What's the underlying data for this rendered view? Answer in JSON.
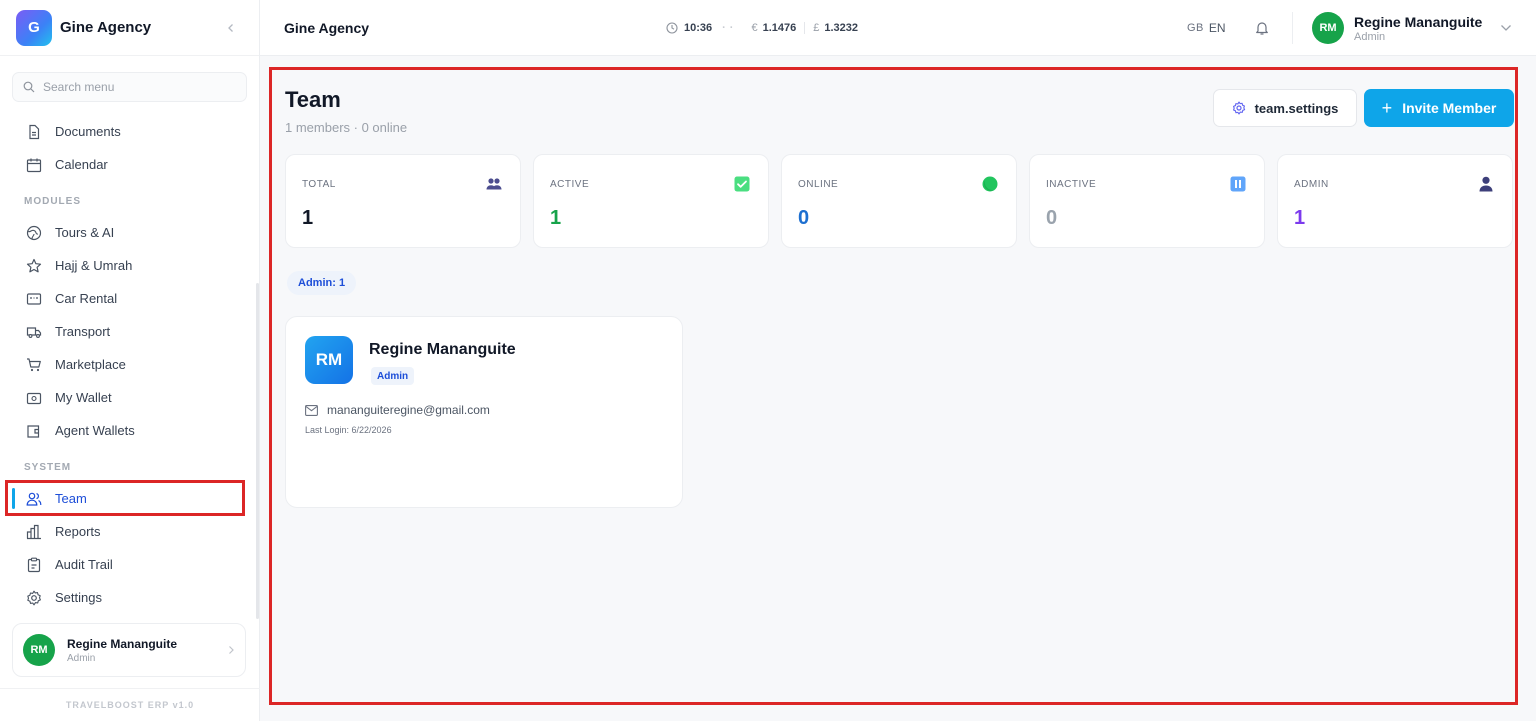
{
  "brand": {
    "logo_letter": "G",
    "name": "Gine Agency"
  },
  "sidebar": {
    "search_placeholder": "Search menu",
    "items_top": [
      {
        "label": "Documents",
        "icon": "document-icon"
      },
      {
        "label": "Calendar",
        "icon": "calendar-icon"
      }
    ],
    "modules_title": "MODULES",
    "items_modules": [
      {
        "label": "Tours & AI",
        "icon": "globe-icon"
      },
      {
        "label": "Hajj & Umrah",
        "icon": "star-icon"
      },
      {
        "label": "Car Rental",
        "icon": "car-icon"
      },
      {
        "label": "Transport",
        "icon": "truck-icon"
      },
      {
        "label": "Marketplace",
        "icon": "cart-icon"
      },
      {
        "label": "My Wallet",
        "icon": "wallet-icon"
      },
      {
        "label": "Agent Wallets",
        "icon": "wallets-icon"
      }
    ],
    "system_title": "SYSTEM",
    "items_system": [
      {
        "label": "Team",
        "icon": "users-icon",
        "active": true
      },
      {
        "label": "Reports",
        "icon": "bar-chart-icon"
      },
      {
        "label": "Audit Trail",
        "icon": "clipboard-icon"
      },
      {
        "label": "Settings",
        "icon": "gear-icon"
      }
    ],
    "user": {
      "initials": "RM",
      "name": "Regine Mananguite",
      "role": "Admin"
    },
    "version": "TRAVELBOOST ERP v1.0"
  },
  "header": {
    "title": "Gine Agency",
    "time": "10:36",
    "eur_symbol": "€",
    "eur_rate": "1.1476",
    "gbp_symbol": "£",
    "gbp_rate": "1.3232",
    "flag": "GB",
    "lang": "EN",
    "user": {
      "initials": "RM",
      "name": "Regine Mananguite",
      "role": "Admin"
    }
  },
  "page": {
    "title": "Team",
    "subtitle": "1 members · 0 online",
    "settings_label": "team.settings",
    "invite_label": "Invite Member",
    "stats": [
      {
        "label": "TOTAL",
        "value": "1",
        "color": "#111827",
        "icon": "users-icon"
      },
      {
        "label": "ACTIVE",
        "value": "1",
        "color": "#16a34a",
        "icon": "check-icon"
      },
      {
        "label": "ONLINE",
        "value": "0",
        "color": "#1d6fd0",
        "icon": "online-dot-icon"
      },
      {
        "label": "INACTIVE",
        "value": "0",
        "color": "#9aa3ad",
        "icon": "pause-icon"
      },
      {
        "label": "ADMIN",
        "value": "1",
        "color": "#7c3aed",
        "icon": "person-icon"
      }
    ],
    "role_filter": "Admin: 1",
    "members": [
      {
        "initials": "RM",
        "name": "Regine Mananguite",
        "role": "Admin",
        "email": "mananguiteregine@gmail.com",
        "last_login": "Last Login: 6/22/2026"
      }
    ]
  },
  "colors": {
    "accent": "#0ea5e9",
    "highlight": "#dc2626",
    "avatar_green": "#16a34a"
  }
}
